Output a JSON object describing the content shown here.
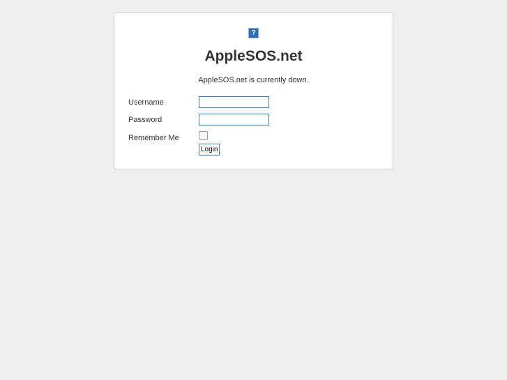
{
  "site": {
    "title": "AppleSOS.net",
    "message": "AppleSOS.net is currently down."
  },
  "icon": "broken-image-icon",
  "form": {
    "username_label": "Username",
    "username_value": "",
    "password_label": "Password",
    "password_value": "",
    "remember_label": "Remember Me",
    "remember_checked": false,
    "login_label": "Login"
  }
}
